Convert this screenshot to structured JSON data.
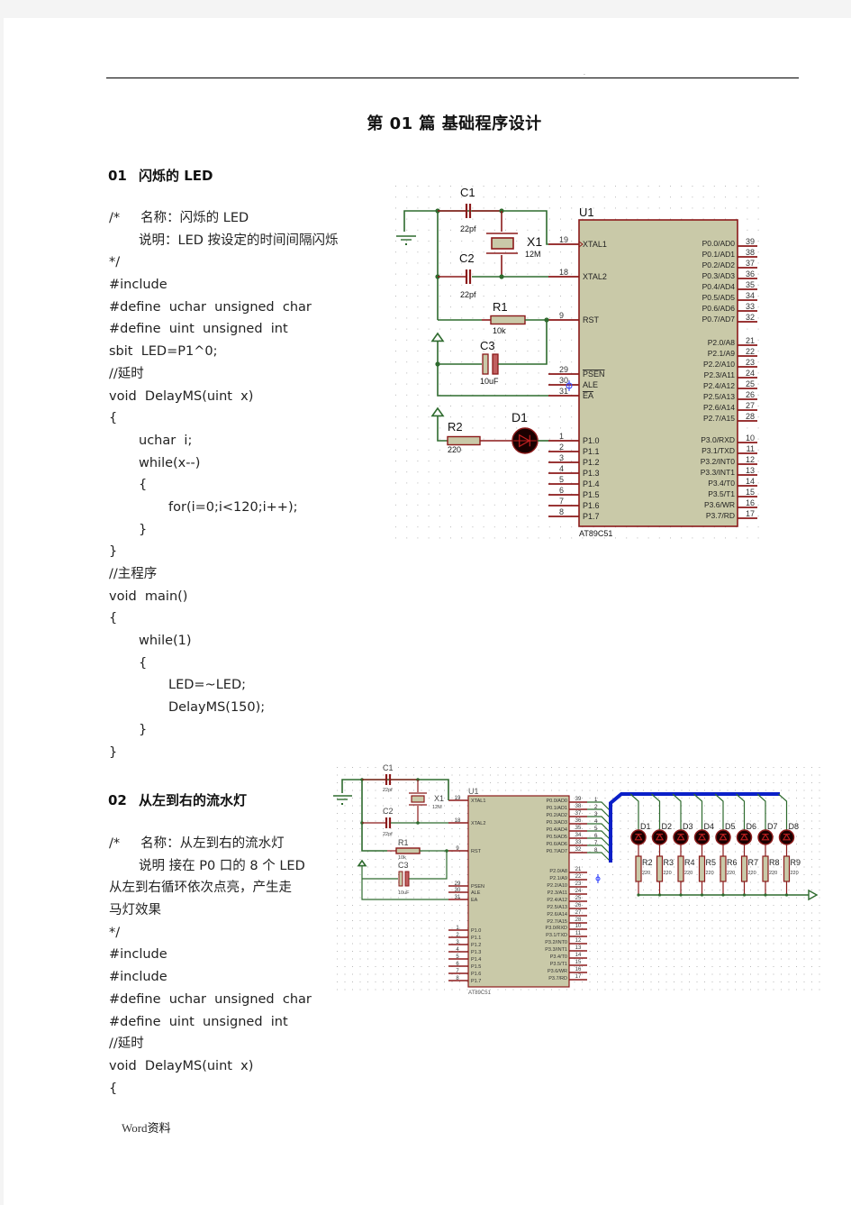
{
  "document": {
    "header_mark": ".",
    "title_prefix": "第 01 篇",
    "title_main": "基础程序设计",
    "footer_word": "Word",
    "footer_suffix": "资料"
  },
  "sections": [
    {
      "number": "01",
      "heading": "闪烁的 LED",
      "code": [
        {
          "indent": 0,
          "text": "/*     名称：闪烁的 LED"
        },
        {
          "indent": 1,
          "text": "说明：LED 按设定的时间间隔闪烁"
        },
        {
          "indent": 0,
          "text": "*/"
        },
        {
          "indent": 0,
          "text": "#include"
        },
        {
          "indent": 0,
          "text": "#define  uchar  unsigned  char"
        },
        {
          "indent": 0,
          "text": "#define  uint  unsigned  int"
        },
        {
          "indent": 0,
          "text": "sbit  LED=P1^0;"
        },
        {
          "indent": 0,
          "text": "//延时"
        },
        {
          "indent": 0,
          "text": "void  DelayMS(uint  x)"
        },
        {
          "indent": 0,
          "text": "{"
        },
        {
          "indent": 1,
          "text": "uchar  i;"
        },
        {
          "indent": 1,
          "text": "while(x--)"
        },
        {
          "indent": 1,
          "text": "{"
        },
        {
          "indent": 2,
          "text": "for(i=0;i<120;i++);"
        },
        {
          "indent": 1,
          "text": "}"
        },
        {
          "indent": 0,
          "text": "}"
        },
        {
          "indent": 0,
          "text": "//主程序"
        },
        {
          "indent": 0,
          "text": "void  main()"
        },
        {
          "indent": 0,
          "text": "{"
        },
        {
          "indent": 1,
          "text": "while(1)"
        },
        {
          "indent": 1,
          "text": "{"
        },
        {
          "indent": 2,
          "text": "LED=~LED;"
        },
        {
          "indent": 2,
          "text": "DelayMS(150);"
        },
        {
          "indent": 1,
          "text": "}"
        },
        {
          "indent": 0,
          "text": "}"
        }
      ]
    },
    {
      "number": "02",
      "heading": "从左到右的流水灯",
      "code": [
        {
          "indent": 0,
          "text": "/*     名称：从左到右的流水灯"
        },
        {
          "indent": 1,
          "text": "说明 接在 P0 口的 8 个 LED"
        },
        {
          "indent": 0,
          "text": "从左到右循环依次点亮，产生走"
        },
        {
          "indent": 0,
          "text": "马灯效果"
        },
        {
          "indent": 0,
          "text": "*/"
        },
        {
          "indent": 0,
          "text": "#include"
        },
        {
          "indent": 0,
          "text": "#include"
        },
        {
          "indent": 0,
          "text": "#define  uchar  unsigned  char"
        },
        {
          "indent": 0,
          "text": "#define  uint  unsigned  int"
        },
        {
          "indent": 0,
          "text": "//延时"
        },
        {
          "indent": 0,
          "text": "void  DelayMS(uint  x)"
        },
        {
          "indent": 0,
          "text": "{"
        }
      ]
    }
  ],
  "schematic1": {
    "chip_ref": "U1",
    "chip_part": "AT89C51",
    "components": {
      "c1": {
        "ref": "C1",
        "value": "22pf"
      },
      "c2": {
        "ref": "C2",
        "value": "22pf"
      },
      "x1": {
        "ref": "X1",
        "value": "12M"
      },
      "r1": {
        "ref": "R1",
        "value": "10k"
      },
      "c3": {
        "ref": "C3",
        "value": "10uF"
      },
      "r2": {
        "ref": "R2",
        "value": "220"
      },
      "d1": {
        "ref": "D1",
        "value": ""
      }
    },
    "left_pins": [
      {
        "num": "19",
        "name": "XTAL1"
      },
      {
        "num": "18",
        "name": "XTAL2"
      },
      {
        "num": "9",
        "name": "RST"
      },
      {
        "num": "29",
        "name": "PSEN",
        "overline": true
      },
      {
        "num": "30",
        "name": "ALE"
      },
      {
        "num": "31",
        "name": "EA",
        "overline": true
      },
      {
        "num": "1",
        "name": "P1.0"
      },
      {
        "num": "2",
        "name": "P1.1"
      },
      {
        "num": "3",
        "name": "P1.2"
      },
      {
        "num": "4",
        "name": "P1.3"
      },
      {
        "num": "5",
        "name": "P1.4"
      },
      {
        "num": "6",
        "name": "P1.5"
      },
      {
        "num": "7",
        "name": "P1.6"
      },
      {
        "num": "8",
        "name": "P1.7"
      }
    ],
    "right_pins": [
      {
        "num": "39",
        "name": "P0.0/AD0"
      },
      {
        "num": "38",
        "name": "P0.1/AD1"
      },
      {
        "num": "37",
        "name": "P0.2/AD2"
      },
      {
        "num": "36",
        "name": "P0.3/AD3"
      },
      {
        "num": "35",
        "name": "P0.4/AD4"
      },
      {
        "num": "34",
        "name": "P0.5/AD5"
      },
      {
        "num": "33",
        "name": "P0.6/AD6"
      },
      {
        "num": "32",
        "name": "P0.7/AD7"
      },
      {
        "num": "21",
        "name": "P2.0/A8"
      },
      {
        "num": "22",
        "name": "P2.1/A9"
      },
      {
        "num": "23",
        "name": "P2.2/A10"
      },
      {
        "num": "24",
        "name": "P2.3/A11"
      },
      {
        "num": "25",
        "name": "P2.4/A12"
      },
      {
        "num": "26",
        "name": "P2.5/A13"
      },
      {
        "num": "27",
        "name": "P2.6/A14"
      },
      {
        "num": "28",
        "name": "P2.7/A15"
      },
      {
        "num": "10",
        "name": "P3.0/RXD"
      },
      {
        "num": "11",
        "name": "P3.1/TXD"
      },
      {
        "num": "12",
        "name": "P3.2/INT0"
      },
      {
        "num": "13",
        "name": "P3.3/INT1"
      },
      {
        "num": "14",
        "name": "P3.4/T0"
      },
      {
        "num": "15",
        "name": "P3.5/T1"
      },
      {
        "num": "16",
        "name": "P3.6/WR"
      },
      {
        "num": "17",
        "name": "P3.7/RD"
      }
    ]
  },
  "schematic2": {
    "chip_ref": "U1",
    "chip_part": "AT89C51",
    "components": {
      "c1": {
        "ref": "C1",
        "value": "22pf"
      },
      "c2": {
        "ref": "C2",
        "value": "22pf"
      },
      "x1": {
        "ref": "X1",
        "value": "12M"
      },
      "r1": {
        "ref": "R1",
        "value": "10k"
      },
      "c3": {
        "ref": "C3",
        "value": "10uF"
      }
    },
    "bus_labels": [
      "1",
      "2",
      "3",
      "4",
      "5",
      "6",
      "7",
      "8"
    ],
    "leds": [
      "D1",
      "D2",
      "D3",
      "D4",
      "D5",
      "D6",
      "D7",
      "D8"
    ],
    "resistors": [
      {
        "ref": "R2",
        "value": "220"
      },
      {
        "ref": "R3",
        "value": "220"
      },
      {
        "ref": "R4",
        "value": "220"
      },
      {
        "ref": "R5",
        "value": "220"
      },
      {
        "ref": "R6",
        "value": "220"
      },
      {
        "ref": "R7",
        "value": "220"
      },
      {
        "ref": "R8",
        "value": "220"
      },
      {
        "ref": "R9",
        "value": "220"
      }
    ]
  },
  "colors": {
    "wire": "#2e6b2e",
    "pin": "#8b1a1a",
    "body": "#c9c9a8",
    "body_stroke": "#8b1a1a",
    "bus": "#0a1fc8",
    "grid": "#b8b8b8",
    "led_fill": "#1a0000",
    "probe": "#2a3cff"
  }
}
